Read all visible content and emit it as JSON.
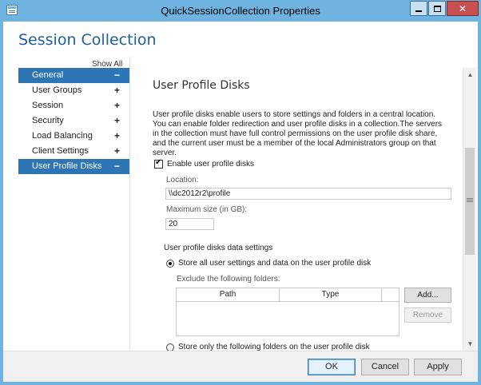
{
  "window": {
    "title": "QuickSessionCollection Properties",
    "icon": "window-app-icon",
    "controls": {
      "minimize": "minimize-icon",
      "maximize": "maximize-icon",
      "close": "✕"
    }
  },
  "header": {
    "title": "Session Collection"
  },
  "sidebar": {
    "show_all": "Show All",
    "items": [
      {
        "label": "General",
        "sign": "−"
      },
      {
        "label": "User Groups",
        "sign": "+"
      },
      {
        "label": "Session",
        "sign": "+"
      },
      {
        "label": "Security",
        "sign": "+"
      },
      {
        "label": "Load Balancing",
        "sign": "+"
      },
      {
        "label": "Client Settings",
        "sign": "+"
      },
      {
        "label": "User Profile Disks",
        "sign": "−"
      }
    ]
  },
  "main": {
    "section_title": "User Profile Disks",
    "description": "User profile disks enable users to store settings and folders in a central location. You can enable folder redirection and user profile disks in a collection.The servers in the collection must have full control permissions on the user profile disk share, and the current user must be a member of the local Administrators group on that server.",
    "enable_checkbox": {
      "label": "Enable user profile disks",
      "checked": true
    },
    "location": {
      "label": "Location:",
      "value": "\\\\dc2012r2\\profile"
    },
    "max_size": {
      "label": "Maximum size (in GB):",
      "value": "20"
    },
    "data_settings_heading": "User profile disks data settings",
    "radio_store_all": {
      "label": "Store all user settings and data on the user profile disk",
      "checked": true
    },
    "exclude_label": "Exclude the following folders:",
    "folders_table": {
      "columns": [
        "Path",
        "Type"
      ],
      "rows": []
    },
    "add_button": "Add...",
    "remove_button": "Remove",
    "radio_store_only": {
      "label": "Store only the following folders on the user profile disk",
      "checked": false
    }
  },
  "scrollbar": {
    "up": "▲",
    "down": "▼",
    "position": 0.45
  },
  "footer": {
    "ok": "OK",
    "cancel": "Cancel",
    "apply": "Apply"
  },
  "colors": {
    "accent": "#2e75b6",
    "title_blue": "#1f5fa0",
    "frame": "#6fb3e0",
    "close_red": "#c75050"
  }
}
